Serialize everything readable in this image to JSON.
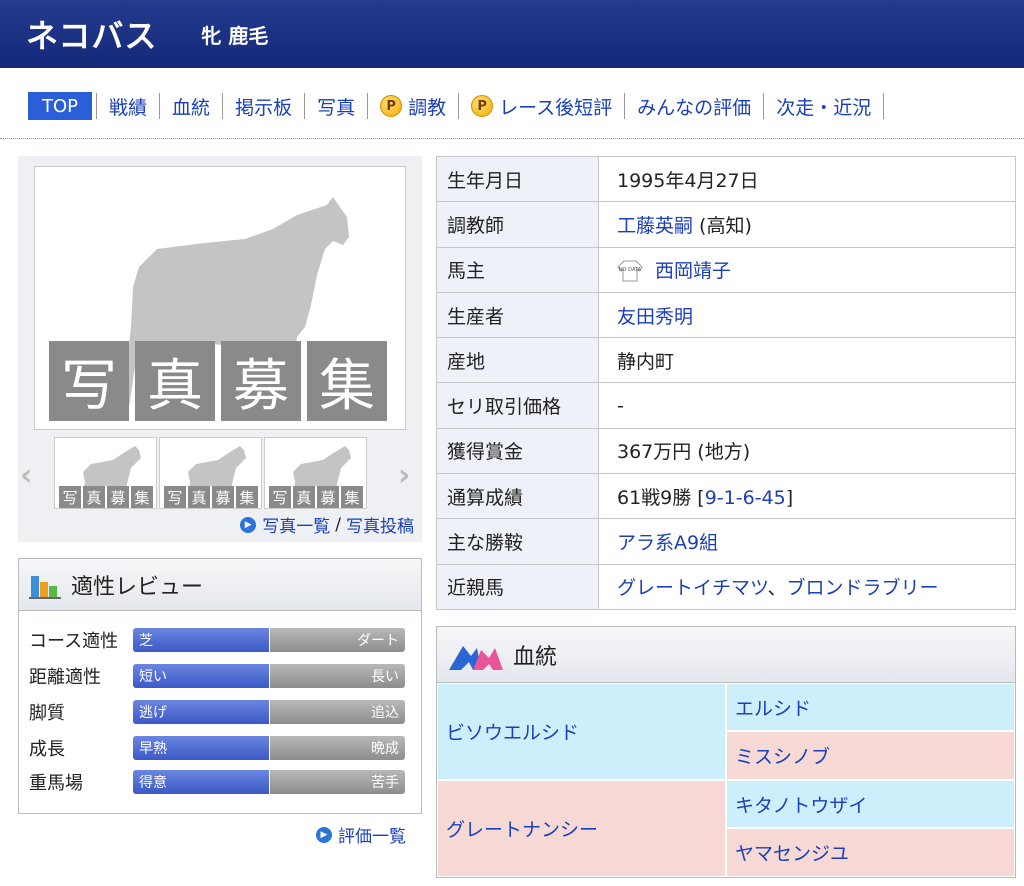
{
  "header": {
    "horse_name": "ネコバス",
    "sex_color": "牝 鹿毛"
  },
  "nav": {
    "tabs": [
      {
        "label": "TOP",
        "active": true
      },
      {
        "label": "戦績"
      },
      {
        "label": "血統"
      },
      {
        "label": "掲示板"
      },
      {
        "label": "写真"
      },
      {
        "label": "調教",
        "premium": true
      },
      {
        "label": "レース後短評",
        "premium": true
      },
      {
        "label": "みんなの評価"
      },
      {
        "label": "次走・近況"
      }
    ],
    "premium_badge": "P"
  },
  "photo": {
    "placeholder_chars": [
      "写",
      "真",
      "募",
      "集"
    ],
    "links": {
      "list": "写真一覧",
      "separator": "/",
      "post": "写真投稿"
    }
  },
  "review": {
    "title": "適性レビュー",
    "rows": [
      {
        "label": "コース適性",
        "left": "芝",
        "right": "ダート"
      },
      {
        "label": "距離適性",
        "left": "短い",
        "right": "長い"
      },
      {
        "label": "脚質",
        "left": "逃げ",
        "right": "追込"
      },
      {
        "label": "成長",
        "left": "早熟",
        "right": "晩成"
      },
      {
        "label": "重馬場",
        "left": "得意",
        "right": "苦手"
      }
    ],
    "link": "評価一覧"
  },
  "profile": {
    "rows": [
      {
        "label": "生年月日",
        "value": "1995年4月27日"
      },
      {
        "label": "調教師",
        "link": "工藤英嗣",
        "suffix": " (高知)"
      },
      {
        "label": "馬主",
        "link": "西岡靖子",
        "silk": "NO DATA"
      },
      {
        "label": "生産者",
        "link": "友田秀明"
      },
      {
        "label": "産地",
        "value": "静内町"
      },
      {
        "label": "セリ取引価格",
        "value": "-"
      },
      {
        "label": "獲得賞金",
        "value": "367万円 (地方)"
      },
      {
        "label": "通算成績",
        "value": "61戦9勝 [",
        "link": "9-1-6-45",
        "suffix": "]"
      },
      {
        "label": "主な勝鞍",
        "link": "アラ系A9組"
      },
      {
        "label": "近親馬",
        "link": "グレートイチマツ",
        "sep": "、",
        "link2": "ブロンドラブリー"
      }
    ]
  },
  "pedigree": {
    "title": "血統",
    "sire": "ビソウエルシド",
    "dam": "グレートナンシー",
    "sire_sire": "エルシド",
    "sire_dam": "ミスシノブ",
    "dam_sire": "キタノトウザイ",
    "dam_dam": "ヤマセンジユ"
  }
}
